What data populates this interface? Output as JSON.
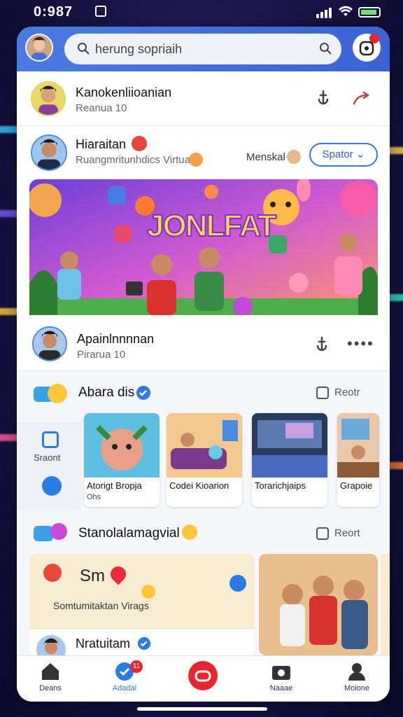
{
  "status": {
    "time": "0:987"
  },
  "search": {
    "text": "herung sopriaih"
  },
  "notifications": {
    "badge": ""
  },
  "post1": {
    "name": "Kanokenliioanian",
    "meta": "Reanua 10"
  },
  "post2": {
    "name": "Hiaraitan",
    "meta": "Ruangmritunhdics Virtua",
    "follow_label": "Menskal",
    "button": "Spator"
  },
  "hero": {
    "title": "JONLFAT"
  },
  "post3": {
    "name": "Apainlnnnnan",
    "meta": "Pirarua 10"
  },
  "section1": {
    "title": "Abara dis",
    "sort": "Reotr"
  },
  "sidebar": {
    "label": "Sraont"
  },
  "cards": [
    {
      "title": "Atorigt Bropja",
      "sub": "Ohs"
    },
    {
      "title": "Codei Kioarion",
      "sub": ""
    },
    {
      "title": "Torarichjaips",
      "sub": ""
    },
    {
      "title": "Grapoie",
      "sub": ""
    }
  ],
  "section2": {
    "title": "Stanolalamagvial",
    "sort": "Reort"
  },
  "feature": {
    "headline": "Sm",
    "caption": "Somtumitaktan Virags",
    "name": "Nratuitam"
  },
  "nav": {
    "home": "Deans",
    "activity": "Adadal",
    "camera": "Naaae",
    "profile": "Moione",
    "activity_badge": "11"
  },
  "colors": {
    "accent": "#3c62d4",
    "red": "#e8262f",
    "check": "#2b7be4"
  }
}
